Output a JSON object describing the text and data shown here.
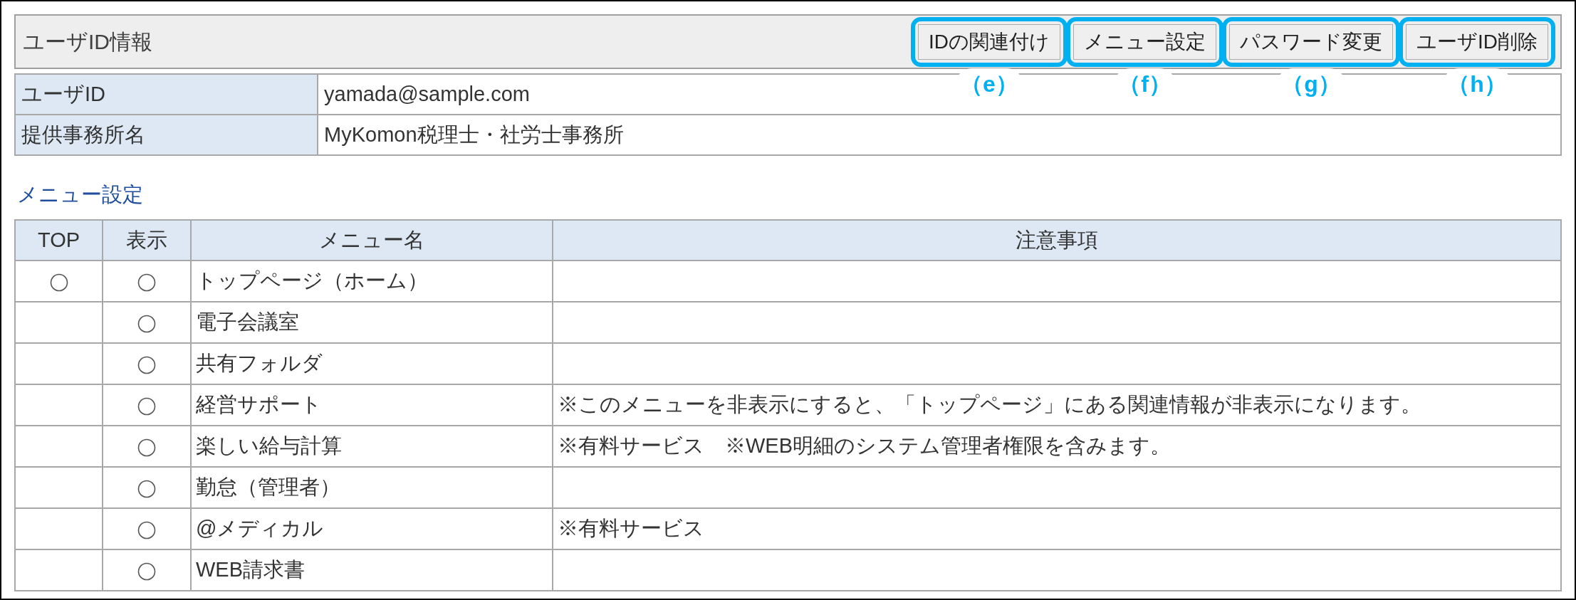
{
  "panel": {
    "title": "ユーザID情報"
  },
  "buttons": [
    {
      "label": "IDの関連付け",
      "highlighted": true,
      "callout": "（e）"
    },
    {
      "label": "メニュー設定",
      "highlighted": true,
      "callout": "（f）"
    },
    {
      "label": "パスワード変更",
      "highlighted": true,
      "callout": "（g）"
    },
    {
      "label": "ユーザID削除",
      "highlighted": true,
      "callout": "（h）"
    }
  ],
  "info": [
    {
      "label": "ユーザID",
      "value": "yamada@sample.com"
    },
    {
      "label": "提供事務所名",
      "value": "MyKomon税理士・社労士事務所"
    }
  ],
  "section_title": "メニュー設定",
  "table": {
    "columns": [
      "TOP",
      "表示",
      "メニュー名",
      "注意事項"
    ],
    "rows": [
      {
        "top": {
          "selected": false
        },
        "display": {
          "selected": false
        },
        "name": "トップページ（ホーム）"
      },
      {
        "display": {
          "selected": false
        },
        "name": "電子会議室"
      },
      {
        "display": {
          "selected": false
        },
        "name": "共有フォルダ"
      },
      {
        "display": {
          "selected": false
        },
        "name": "経営サポート",
        "note": "※このメニューを非表示にすると、「トップページ」にある関連情報が非表示になります。"
      },
      {
        "display": {
          "selected": false
        },
        "name": "楽しい給与計算",
        "note": "※有料サービス　※WEB明細のシステム管理者権限を含みます。"
      },
      {
        "display": {
          "selected": false
        },
        "name": "勤怠（管理者）"
      },
      {
        "display": {
          "selected": false
        },
        "name": "@メディカル",
        "note": "※有料サービス"
      },
      {
        "display": {
          "selected": false
        },
        "name": "WEB請求書"
      }
    ]
  }
}
